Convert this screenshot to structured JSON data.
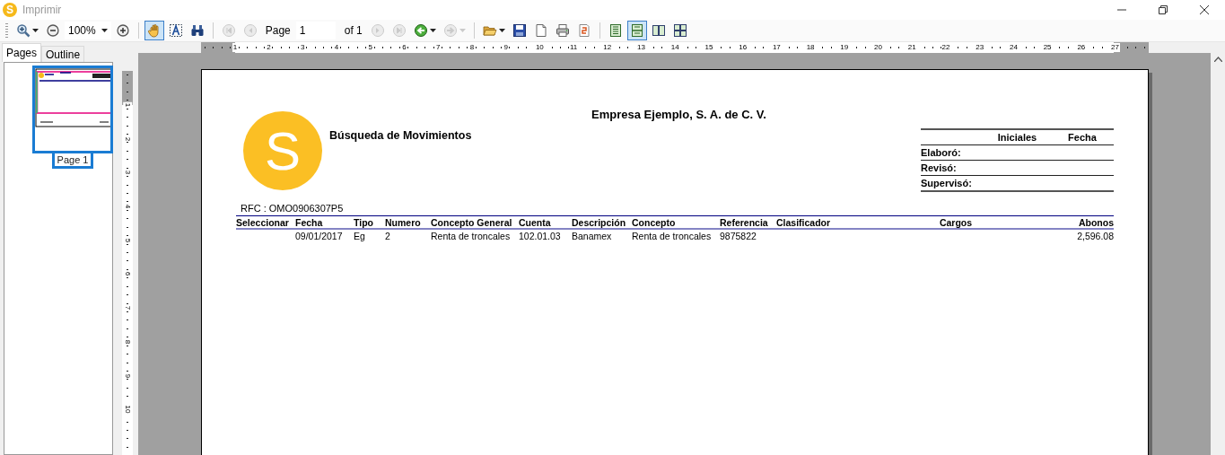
{
  "window": {
    "logo": "S",
    "title": "Imprimir"
  },
  "toolbar": [
    {
      "kind": "button",
      "selected": false,
      "disabled": false,
      "dropdown": true
    },
    {
      "kind": "button",
      "selected": false,
      "disabled": false,
      "dropdown": false
    },
    {
      "kind": "combo",
      "value": "100%"
    },
    {
      "kind": "button",
      "selected": false,
      "disabled": false,
      "dropdown": false
    },
    {
      "kind": "separator"
    },
    {
      "kind": "button",
      "selected": true,
      "disabled": false,
      "dropdown": false
    },
    {
      "kind": "button",
      "selected": false,
      "disabled": false,
      "dropdown": false
    },
    {
      "kind": "button",
      "selected": false,
      "disabled": false,
      "dropdown": false
    },
    {
      "kind": "separator"
    },
    {
      "kind": "button",
      "selected": false,
      "disabled": true,
      "dropdown": false
    },
    {
      "kind": "button",
      "selected": false,
      "disabled": true,
      "dropdown": false
    },
    {
      "kind": "label",
      "text": "Page"
    },
    {
      "kind": "field",
      "value": "1"
    },
    {
      "kind": "label",
      "text": "of 1"
    },
    {
      "kind": "button",
      "selected": false,
      "disabled": true,
      "dropdown": false
    },
    {
      "kind": "button",
      "selected": false,
      "disabled": true,
      "dropdown": false
    },
    {
      "kind": "button",
      "selected": false,
      "disabled": false,
      "dropdown": true
    },
    {
      "kind": "button",
      "selected": false,
      "disabled": true,
      "dropdown": true
    },
    {
      "kind": "separator"
    },
    {
      "kind": "button",
      "selected": false,
      "disabled": false,
      "dropdown": true
    },
    {
      "kind": "button",
      "selected": false,
      "disabled": false,
      "dropdown": false
    },
    {
      "kind": "button",
      "selected": false,
      "disabled": false,
      "dropdown": false
    },
    {
      "kind": "button",
      "selected": false,
      "disabled": false,
      "dropdown": false
    },
    {
      "kind": "button",
      "selected": false,
      "disabled": false,
      "dropdown": false
    },
    {
      "kind": "separator"
    },
    {
      "kind": "button",
      "selected": false,
      "disabled": false,
      "dropdown": false
    },
    {
      "kind": "button",
      "selected": true,
      "disabled": false,
      "dropdown": false
    },
    {
      "kind": "button",
      "selected": false,
      "disabled": false,
      "dropdown": false
    },
    {
      "kind": "button",
      "selected": false,
      "disabled": false,
      "dropdown": false
    }
  ],
  "tabs": [
    {
      "label": "Pages",
      "selected": true
    },
    {
      "label": "Outline",
      "selected": false
    }
  ],
  "thumbnails": [
    {
      "label": "Page 1",
      "selected": true
    }
  ],
  "horizontal_ruler": [
    "1",
    "2",
    "3",
    "4",
    "5",
    "6",
    "7",
    "8",
    "9",
    "10",
    "11",
    "12",
    "13",
    "14",
    "15",
    "16",
    "17",
    "18",
    "19",
    "20",
    "21",
    "22",
    "23",
    "24",
    "25",
    "26",
    "27"
  ],
  "vertical_ruler": [
    "1",
    "2",
    "3",
    "4",
    "5",
    "6",
    "7",
    "8",
    "9",
    "10"
  ],
  "report": {
    "logo": "S",
    "company": "Empresa Ejemplo, S. A. de C. V.",
    "title": "Búsqueda de Movimientos",
    "signatures": {
      "columns": [
        "Iniciales",
        "Fecha"
      ],
      "rows": [
        "Elaboró:",
        "Revisó:",
        "Supervisó:"
      ]
    },
    "rfc": "RFC : OMO0906307P5",
    "table": {
      "columns": [
        "Seleccionar",
        "Fecha",
        "Tipo",
        "Numero",
        "Concepto General",
        "Cuenta",
        "Descripción",
        "Concepto",
        "Referencia",
        "Clasificador",
        "Cargos",
        "Abonos"
      ],
      "rows": [
        [
          "",
          "09/01/2017",
          "Eg",
          "2",
          "Renta de troncales",
          "102.01.03",
          "Banamex",
          "Renta de troncales",
          "9875822",
          "",
          "",
          "2,596.08"
        ]
      ]
    }
  }
}
